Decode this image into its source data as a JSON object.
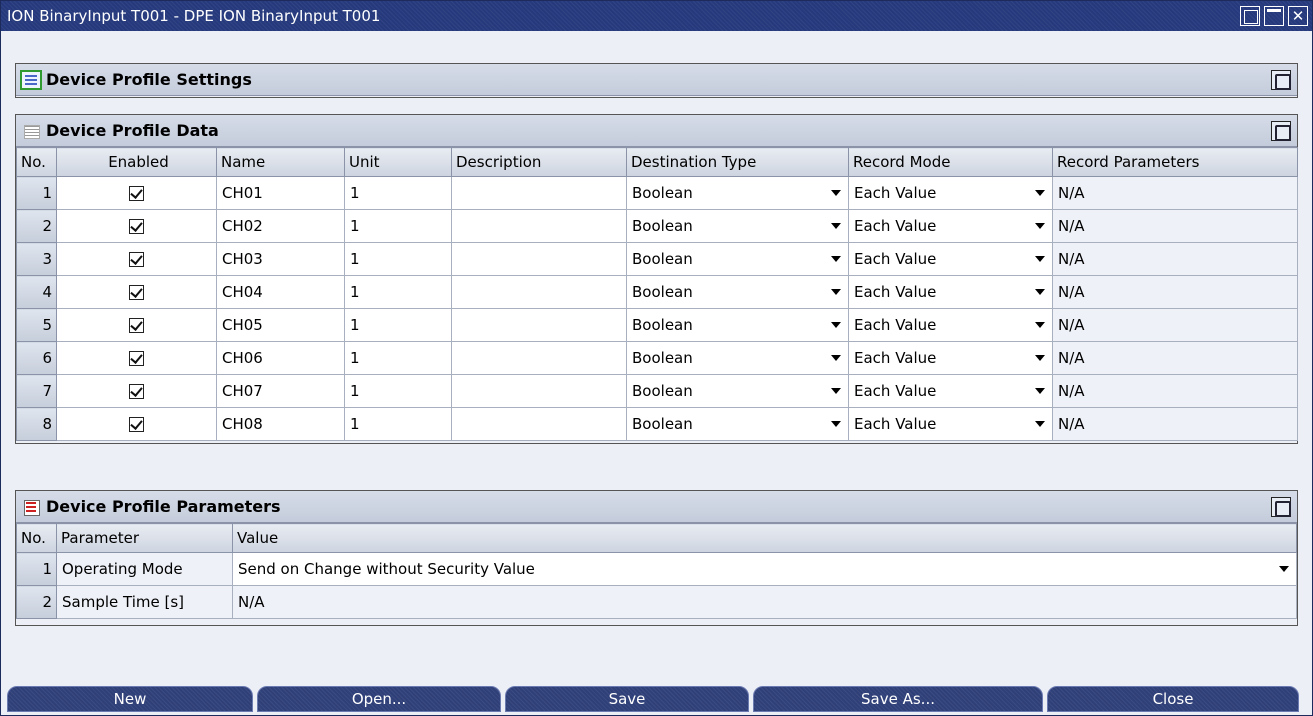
{
  "window": {
    "title": "ION BinaryInput T001 - DPE ION BinaryInput T001",
    "close_glyph": "✕"
  },
  "settings_panel": {
    "title": "Device Profile Settings"
  },
  "data_panel": {
    "title": "Device Profile Data",
    "columns": [
      "No.",
      "Enabled",
      "Name",
      "Unit",
      "Description",
      "Destination Type",
      "Record Mode",
      "Record Parameters"
    ],
    "rows": [
      {
        "no": "1",
        "enabled": true,
        "name": "CH01",
        "unit": "1",
        "description": "",
        "destination_type": "Boolean",
        "record_mode": "Each Value",
        "record_parameters": "N/A"
      },
      {
        "no": "2",
        "enabled": true,
        "name": "CH02",
        "unit": "1",
        "description": "",
        "destination_type": "Boolean",
        "record_mode": "Each Value",
        "record_parameters": "N/A"
      },
      {
        "no": "3",
        "enabled": true,
        "name": "CH03",
        "unit": "1",
        "description": "",
        "destination_type": "Boolean",
        "record_mode": "Each Value",
        "record_parameters": "N/A"
      },
      {
        "no": "4",
        "enabled": true,
        "name": "CH04",
        "unit": "1",
        "description": "",
        "destination_type": "Boolean",
        "record_mode": "Each Value",
        "record_parameters": "N/A"
      },
      {
        "no": "5",
        "enabled": true,
        "name": "CH05",
        "unit": "1",
        "description": "",
        "destination_type": "Boolean",
        "record_mode": "Each Value",
        "record_parameters": "N/A"
      },
      {
        "no": "6",
        "enabled": true,
        "name": "CH06",
        "unit": "1",
        "description": "",
        "destination_type": "Boolean",
        "record_mode": "Each Value",
        "record_parameters": "N/A"
      },
      {
        "no": "7",
        "enabled": true,
        "name": "CH07",
        "unit": "1",
        "description": "",
        "destination_type": "Boolean",
        "record_mode": "Each Value",
        "record_parameters": "N/A"
      },
      {
        "no": "8",
        "enabled": true,
        "name": "CH08",
        "unit": "1",
        "description": "",
        "destination_type": "Boolean",
        "record_mode": "Each Value",
        "record_parameters": "N/A"
      }
    ]
  },
  "params_panel": {
    "title": "Device Profile Parameters",
    "columns": [
      "No.",
      "Parameter",
      "Value"
    ],
    "rows": [
      {
        "no": "1",
        "parameter": "Operating Mode",
        "value": "Send on Change without Security Value",
        "dropdown": true
      },
      {
        "no": "2",
        "parameter": "Sample Time [s]",
        "value": "N/A",
        "dropdown": false
      }
    ]
  },
  "buttons": {
    "new": "New",
    "open": "Open...",
    "save": "Save",
    "save_as": "Save As...",
    "close": "Close"
  }
}
